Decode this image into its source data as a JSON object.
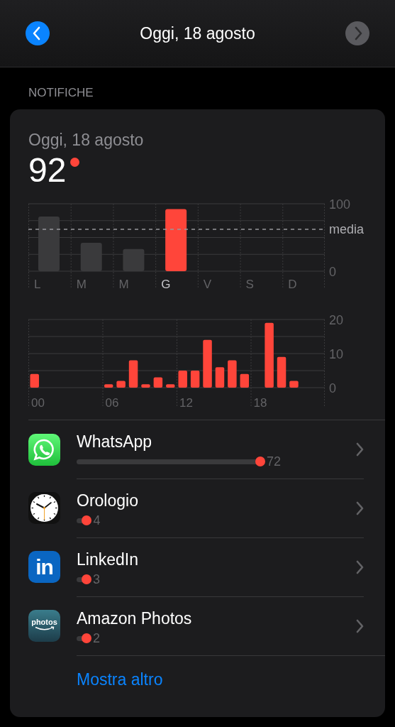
{
  "header": {
    "title": "Oggi, 18 agosto",
    "back_button": {
      "disabled": false
    },
    "forward_button": {
      "disabled": true
    }
  },
  "section_label": "NOTIFICHE",
  "card": {
    "date": "Oggi, 18 agosto",
    "total": "92",
    "unread": true,
    "week_chart": {
      "average_label": "media",
      "chart_data": {
        "type": "bar",
        "categories": [
          "L",
          "M",
          "M",
          "G",
          "V",
          "S",
          "D"
        ],
        "series": [
          {
            "color": "#3a3a3c",
            "values": [
              81,
              42,
              33,
              null,
              null,
              null,
              null
            ]
          },
          {
            "color": "#ff453a",
            "values": [
              null,
              null,
              null,
              92,
              null,
              null,
              null
            ]
          }
        ],
        "ylim": [
          0,
          100
        ],
        "yticks": [
          0,
          100
        ]
      }
    },
    "hour_chart": {
      "chart_data": {
        "type": "bar",
        "x": [
          0,
          6,
          7,
          8,
          9,
          10,
          11,
          12,
          13,
          14,
          15,
          16,
          17,
          19,
          20,
          21
        ],
        "series": [
          {
            "color": "#ff453a",
            "values": [
              4,
              1,
              2,
              8,
              1,
              3,
              1,
              5,
              5,
              14,
              6,
              8,
              4,
              19,
              9,
              2
            ]
          }
        ],
        "xlim": [
          -0.5,
          23.5
        ],
        "ylim": [
          0,
          20
        ],
        "yticks": [
          0,
          10,
          20
        ],
        "xticks": [
          {
            "value": 0,
            "label": "00"
          },
          {
            "value": 6,
            "label": "06"
          },
          {
            "value": 12,
            "label": "12"
          },
          {
            "value": 18,
            "label": "18"
          }
        ]
      }
    },
    "apps": [
      {
        "kind": "chat",
        "name": "WhatsApp",
        "count": "72"
      },
      {
        "kind": "clock",
        "name": "Orologio",
        "count": "4"
      },
      {
        "kind": "letters",
        "icon_label": "in",
        "name": "LinkedIn",
        "count": "3"
      },
      {
        "kind": "photos",
        "icon_label": "photos",
        "name": "Amazon Photos",
        "count": "2"
      }
    ],
    "show_more": "Mostra altro"
  }
}
